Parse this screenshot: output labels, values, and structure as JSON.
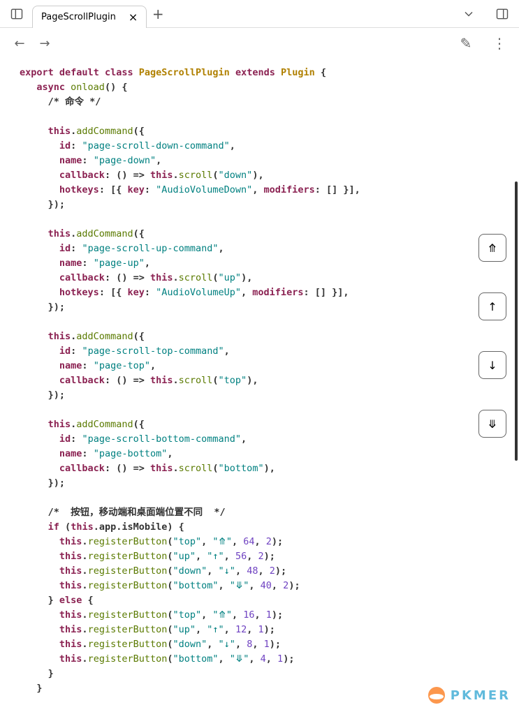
{
  "tab": {
    "title": "PageScrollPlugin"
  },
  "scrollButtons": {
    "top": "⤊",
    "up": "↑",
    "down": "↓",
    "bottom": "⤋"
  },
  "watermark": "PKMER",
  "code": {
    "kw_export": "export",
    "kw_default": "default",
    "kw_class": "class",
    "classname": "PageScrollPlugin",
    "kw_extends": "extends",
    "supercls": "Plugin",
    "kw_async": "async",
    "onload": "onload",
    "comment_cmds": "/* 命令 */",
    "this": "this",
    "addCommand": "addCommand",
    "id": "id",
    "name": "name",
    "callback": "callback",
    "scroll": "scroll",
    "hotkeys": "hotkeys",
    "key": "key",
    "modifiers": "modifiers",
    "cmd1_id": "\"page-scroll-down-command\"",
    "cmd1_name": "\"page-down\"",
    "cmd1_dir": "\"down\"",
    "cmd1_key": "\"AudioVolumeDown\"",
    "cmd2_id": "\"page-scroll-up-command\"",
    "cmd2_name": "\"page-up\"",
    "cmd2_dir": "\"up\"",
    "cmd2_key": "\"AudioVolumeUp\"",
    "cmd3_id": "\"page-scroll-top-command\"",
    "cmd3_name": "\"page-top\"",
    "cmd3_dir": "\"top\"",
    "cmd4_id": "\"page-scroll-bottom-command\"",
    "cmd4_name": "\"page-bottom\"",
    "cmd4_dir": "\"bottom\"",
    "comment_btn": "/*  按钮，移动端和桌面端位置不同  */",
    "kw_if": "if",
    "kw_else": "else",
    "app": "app",
    "isMobile": "isMobile",
    "registerButton": "registerButton",
    "s_top": "\"top\"",
    "s_up": "\"up\"",
    "s_down": "\"down\"",
    "s_bottom": "\"bottom\"",
    "i_top": "\"⤊\"",
    "i_up": "\"↑\"",
    "i_down": "\"↓\"",
    "i_bottom": "\"⤋\"",
    "n64": "64",
    "n56": "56",
    "n48": "48",
    "n40": "40",
    "n16": "16",
    "n12": "12",
    "n8": "8",
    "n4": "4",
    "n2": "2",
    "n1": "1"
  }
}
